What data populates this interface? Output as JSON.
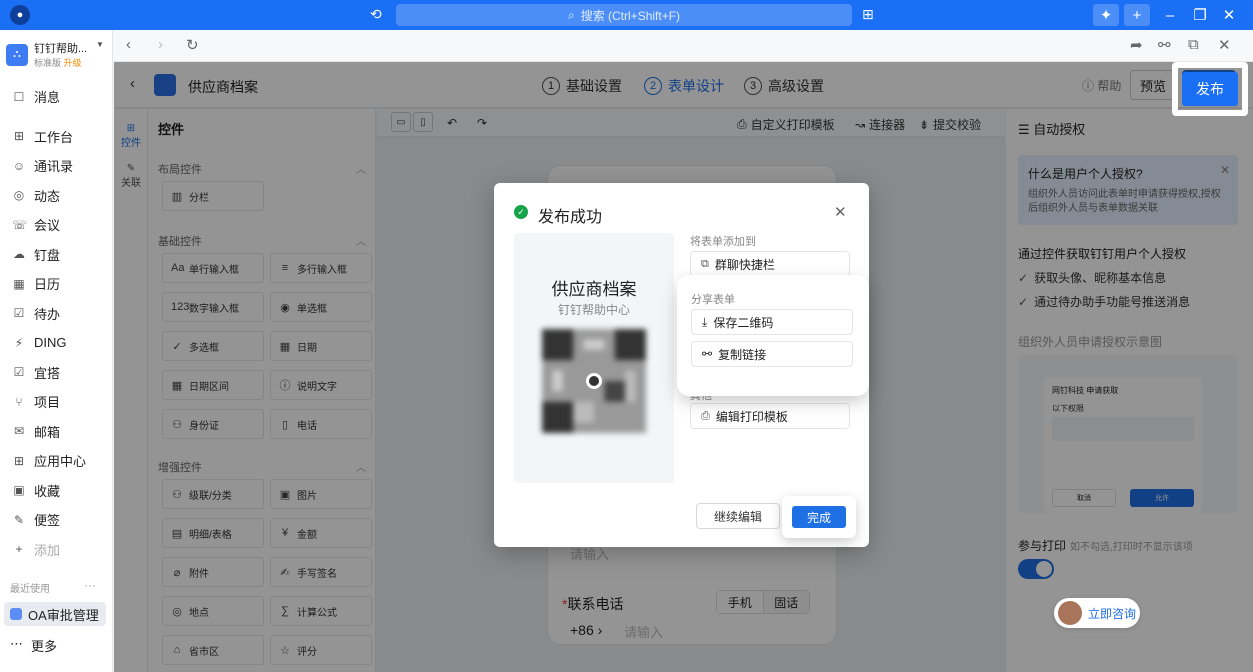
{
  "titlebar": {
    "search_placeholder": "搜索 (Ctrl+Shift+F)"
  },
  "sidebar": {
    "org_name": "钉钉帮助...",
    "org_edition": "标准版",
    "org_upgrade": "升级",
    "items": [
      {
        "label": "消息",
        "icon": "message-icon"
      },
      {
        "label": "工作台",
        "icon": "grid-icon"
      },
      {
        "label": "通讯录",
        "icon": "contacts-icon"
      },
      {
        "label": "动态",
        "icon": "feed-icon"
      },
      {
        "label": "会议",
        "icon": "meeting-icon"
      },
      {
        "label": "钉盘",
        "icon": "drive-icon"
      },
      {
        "label": "日历",
        "icon": "calendar-icon"
      },
      {
        "label": "待办",
        "icon": "todo-icon"
      },
      {
        "label": "DING",
        "icon": "ding-icon"
      },
      {
        "label": "宜搭",
        "icon": "yida-icon"
      },
      {
        "label": "项目",
        "icon": "project-icon"
      },
      {
        "label": "邮箱",
        "icon": "mail-icon"
      },
      {
        "label": "应用中心",
        "icon": "apps-icon"
      },
      {
        "label": "收藏",
        "icon": "favorite-icon"
      },
      {
        "label": "便签",
        "icon": "note-icon"
      },
      {
        "label": "添加",
        "icon": "plus-icon"
      }
    ],
    "recent_label": "最近使用",
    "recent_app": "OA审批管理",
    "more_label": "更多"
  },
  "app": {
    "form_title": "供应商档案",
    "steps": [
      {
        "num": "1",
        "label": "基础设置"
      },
      {
        "num": "2",
        "label": "表单设计"
      },
      {
        "num": "3",
        "label": "高级设置"
      }
    ],
    "help": "帮助",
    "preview": "预览",
    "publish": "发布"
  },
  "rail": {
    "controls": "控件",
    "relation": "关联"
  },
  "controls": {
    "title": "控件",
    "layout_group": "布局控件",
    "basic_group": "基础控件",
    "enhanced_group": "增强控件",
    "layout_items": [
      "分栏"
    ],
    "basic_items": [
      "单行输入框",
      "多行输入框",
      "数字输入框",
      "单选框",
      "多选框",
      "日期",
      "日期区间",
      "说明文字",
      "身份证",
      "电话"
    ],
    "enhanced_items": [
      "级联/分类",
      "图片",
      "明细/表格",
      "金额",
      "附件",
      "手写签名",
      "地点",
      "计算公式",
      "省市区",
      "评分"
    ]
  },
  "canvas": {
    "print_template": "自定义打印模板",
    "connector": "连接器",
    "submit_check": "提交校验",
    "placeholder": "请输入",
    "phone_label": "联系电话",
    "mobile": "手机",
    "landline": "固话",
    "code": "+86",
    "phone_placeholder": "请输入"
  },
  "right_panel": {
    "title": "自动授权",
    "tip_title": "什么是用户个人授权?",
    "tip_body": "组织外人员访问此表单时申请获得授权,授权后组织外人员与表单数据关联",
    "sub_title": "通过控件获取钉钉用户个人授权",
    "check1": "获取头像、昵称基本信息",
    "check2": "通过待办助手功能号推送消息",
    "illustration_caption": "组织外人员申请授权示意图",
    "illu_head": "网钉科技 申请获取",
    "illu_sub": "以下权限",
    "illu_cancel": "取消",
    "illu_ok": "允许",
    "print_label": "参与打印",
    "print_hint": "如不勾选,打印时不显示该项",
    "consult": "立即咨询"
  },
  "modal": {
    "title": "发布成功",
    "qr_form_name": "供应商档案",
    "qr_org": "钉钉帮助中心",
    "add_to_label": "将表单添加到",
    "group_shortcut": "群聊快捷栏",
    "share_label": "分享表单",
    "save_qr": "保存二维码",
    "copy_link": "复制链接",
    "other_label": "其他",
    "edit_print": "编辑打印模板",
    "continue_edit": "继续编辑",
    "done": "完成"
  }
}
